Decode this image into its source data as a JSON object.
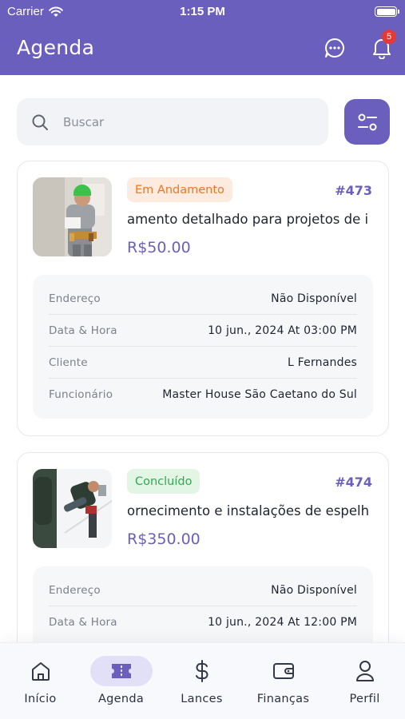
{
  "status_bar": {
    "carrier": "Carrier",
    "time": "1:15 PM"
  },
  "header": {
    "title": "Agenda",
    "notifications_count": "5",
    "accent": "#6b5fbd"
  },
  "search": {
    "placeholder": "Buscar",
    "value": ""
  },
  "orders": [
    {
      "status": "Em Andamento",
      "id": "#473",
      "title_visible": "amento detalhado para projetos de i",
      "price": "R$50.00",
      "details": [
        {
          "label": "Endereço",
          "value": "Não Disponível"
        },
        {
          "label": "Data & Hora",
          "value": "10 jun., 2024 At 03:00 PM"
        },
        {
          "label": "Cliente",
          "value": "L Fernandes"
        },
        {
          "label": "Funcionário",
          "value": "Master House São Caetano do Sul"
        }
      ]
    },
    {
      "status": "Concluído",
      "id": "#474",
      "title_visible": "ornecimento e instalações de espelh",
      "price": "R$350.00",
      "details": [
        {
          "label": "Endereço",
          "value": "Não Disponível"
        },
        {
          "label": "Data & Hora",
          "value": "10 jun., 2024 At 12:00 PM"
        }
      ]
    }
  ],
  "nav": [
    {
      "label": "Início",
      "icon": "home-icon"
    },
    {
      "label": "Agenda",
      "icon": "ticket-icon",
      "active": true
    },
    {
      "label": "Lances",
      "icon": "dollar-icon"
    },
    {
      "label": "Finanças",
      "icon": "wallet-icon"
    },
    {
      "label": "Perfil",
      "icon": "person-icon"
    }
  ]
}
